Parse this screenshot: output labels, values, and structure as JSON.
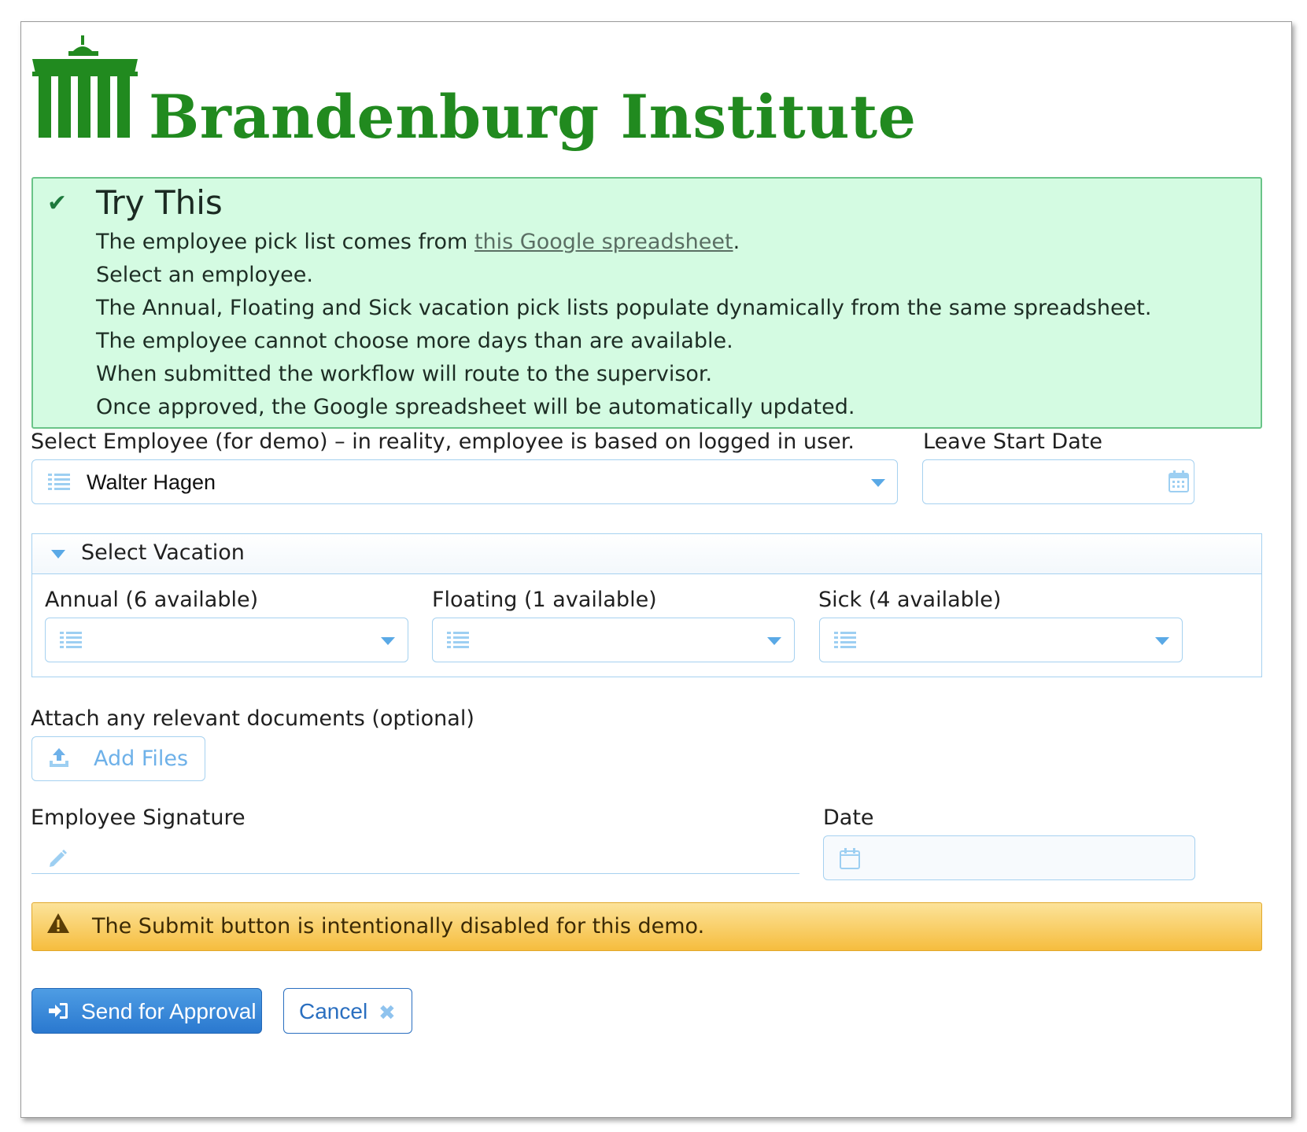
{
  "header": {
    "brand": "Brandenburg Institute",
    "logo_icon": "brandenburg-gate-icon",
    "brand_color": "#218a1f"
  },
  "try_this": {
    "title": "Try This",
    "line1_prefix": "The employee pick list comes from ",
    "line1_link": "this Google spreadsheet",
    "line1_suffix": ".",
    "line2": "Select an employee.",
    "line3": "The Annual, Floating and Sick vacation pick lists populate dynamically from the same spreadsheet.",
    "line4": "The employee cannot choose more days than are available.",
    "line5": "When submitted the workflow will route to the supervisor.",
    "line6": "Once approved, the Google spreadsheet will be automatically updated.",
    "background": "#d4fbe2"
  },
  "employee": {
    "label": "Select Employee (for demo) – in reality, employee is based on logged in user.",
    "value": "Walter Hagen"
  },
  "leave_start": {
    "label": "Leave Start Date",
    "value": ""
  },
  "vacation": {
    "title": "Select Vacation",
    "annual_label": "Annual (6 available)",
    "floating_label": "Floating (1 available)",
    "sick_label": "Sick (4 available)"
  },
  "attachments": {
    "label": "Attach any relevant documents (optional)",
    "button": "Add Files"
  },
  "signature": {
    "label": "Employee Signature",
    "date_label": "Date"
  },
  "warning": {
    "text": "The Submit button is intentionally disabled for this demo.",
    "color": "#f6bd3e"
  },
  "actions": {
    "submit": "Send for Approval",
    "cancel": "Cancel",
    "accent": "#2a78cf"
  }
}
